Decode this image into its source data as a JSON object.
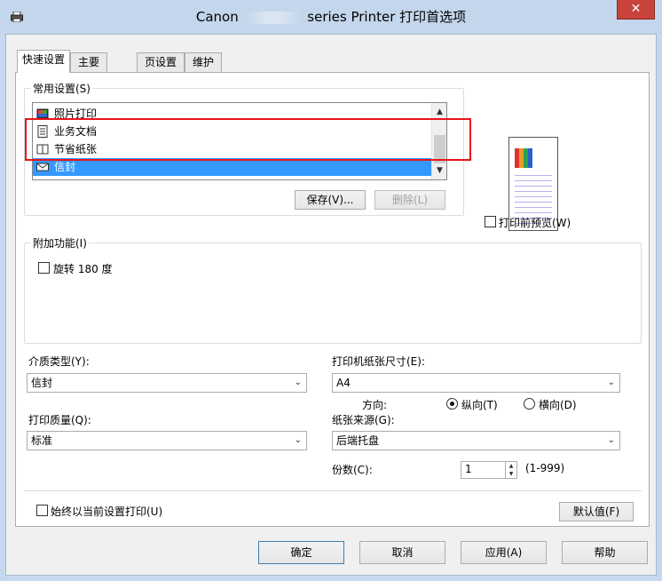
{
  "window": {
    "title_prefix": "Canon",
    "title_suffix": "series Printer 打印首选项",
    "close_glyph": "✕"
  },
  "tabs": [
    {
      "label": "快速设置",
      "active": true
    },
    {
      "label": "主要",
      "active": false
    },
    {
      "label": "页设置",
      "active": false
    },
    {
      "label": "维护",
      "active": false
    }
  ],
  "common_settings": {
    "group_label": "常用设置(S)",
    "items": [
      {
        "label": "照片打印",
        "icon": "photo-icon"
      },
      {
        "label": "业务文档",
        "icon": "document-icon"
      },
      {
        "label": "节省纸张",
        "icon": "paper-saving-icon"
      },
      {
        "label": "信封",
        "icon": "envelope-icon",
        "selected": true
      }
    ],
    "save_button": "保存(V)...",
    "delete_button": "删除(L)"
  },
  "preview": {
    "checkbox_label": "打印前预览(W)",
    "checked": false
  },
  "additional_features": {
    "group_label": "附加功能(I)",
    "rotate_label": "旋转 180 度",
    "rotate_checked": false
  },
  "media_type": {
    "label": "介质类型(Y):",
    "value": "信封"
  },
  "printer_paper_size": {
    "label": "打印机纸张尺寸(E):",
    "value": "A4"
  },
  "orientation": {
    "label": "方向:",
    "portrait_label": "纵向(T)",
    "landscape_label": "横向(D)",
    "selected": "portrait"
  },
  "print_quality": {
    "label": "打印质量(Q):",
    "value": "标准"
  },
  "paper_source": {
    "label": "纸张来源(G):",
    "value": "后端托盘"
  },
  "copies": {
    "label": "份数(C):",
    "value": "1",
    "range": "(1-999)"
  },
  "always_print": {
    "label": "始终以当前设置打印(U)",
    "checked": false
  },
  "defaults_button": "默认值(F)",
  "footer": {
    "ok": "确定",
    "cancel": "取消",
    "apply": "应用(A)",
    "help": "帮助"
  },
  "colors": {
    "selection": "#3399ff",
    "highlight_frame": "#e8141a",
    "close_button": "#c8433b",
    "titlebar": "#c3d6ec"
  }
}
